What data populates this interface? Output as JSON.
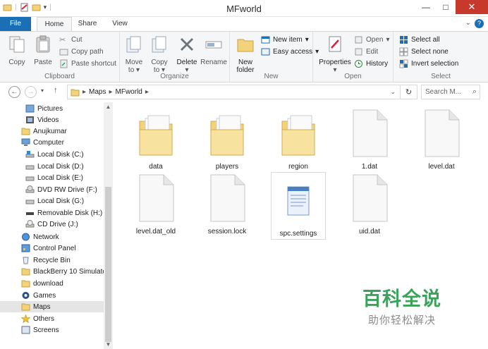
{
  "window": {
    "title": "MFworld"
  },
  "tabs": [
    {
      "label": "File"
    },
    {
      "label": "Home"
    },
    {
      "label": "Share"
    },
    {
      "label": "View"
    }
  ],
  "ribbon": {
    "clipboard": {
      "label": "Clipboard",
      "copy": "Copy",
      "paste": "Paste",
      "cut": "Cut",
      "copy_path": "Copy path",
      "paste_shortcut": "Paste shortcut"
    },
    "organize": {
      "label": "Organize",
      "move_to": "Move",
      "move_to2": "to",
      "copy_to": "Copy",
      "copy_to2": "to",
      "delete": "Delete",
      "rename": "Rename"
    },
    "new": {
      "label": "New",
      "new_folder": "New",
      "new_folder2": "folder",
      "new_item": "New item",
      "easy_access": "Easy access"
    },
    "open": {
      "label": "Open",
      "properties": "Properties",
      "open": "Open",
      "edit": "Edit",
      "history": "History"
    },
    "select": {
      "label": "Select",
      "select_all": "Select all",
      "select_none": "Select none",
      "invert": "Invert selection"
    }
  },
  "address": {
    "crumbs": [
      "Maps",
      "MFworld"
    ],
    "search_placeholder": "Search M..."
  },
  "nav": [
    {
      "label": "Pictures",
      "icon": "pictures-icon"
    },
    {
      "label": "Videos",
      "icon": "videos-icon"
    },
    {
      "label": "Anujkumar",
      "icon": "user-folder-icon"
    },
    {
      "label": "Computer",
      "icon": "computer-icon"
    },
    {
      "label": "Local Disk (C:)",
      "icon": "system-drive-icon"
    },
    {
      "label": "Local Disk (D:)",
      "icon": "drive-icon"
    },
    {
      "label": "Local Disk (E:)",
      "icon": "drive-icon"
    },
    {
      "label": "DVD RW Drive (F:)",
      "icon": "dvd-drive-icon"
    },
    {
      "label": "Local Disk (G:)",
      "icon": "drive-icon"
    },
    {
      "label": "Removable Disk (H:)",
      "icon": "removable-drive-icon"
    },
    {
      "label": "CD Drive (J:)",
      "icon": "cd-drive-icon"
    },
    {
      "label": "Network",
      "icon": "network-icon"
    },
    {
      "label": "Control Panel",
      "icon": "control-panel-icon"
    },
    {
      "label": "Recycle Bin",
      "icon": "recycle-bin-icon"
    },
    {
      "label": "BlackBerry 10 Simulato",
      "icon": "folder-icon"
    },
    {
      "label": "download",
      "icon": "folder-icon"
    },
    {
      "label": "Games",
      "icon": "games-icon"
    },
    {
      "label": "Maps",
      "icon": "folder-icon"
    },
    {
      "label": "Others",
      "icon": "star-icon"
    },
    {
      "label": "Screens",
      "icon": "screens-icon"
    }
  ],
  "files": [
    {
      "name": "data",
      "type": "folder"
    },
    {
      "name": "players",
      "type": "folder"
    },
    {
      "name": "region",
      "type": "folder"
    },
    {
      "name": "1.dat",
      "type": "file"
    },
    {
      "name": "level.dat",
      "type": "file"
    },
    {
      "name": "level.dat_old",
      "type": "file"
    },
    {
      "name": "session.lock",
      "type": "file"
    },
    {
      "name": "spc.settings",
      "type": "doc"
    },
    {
      "name": "uid.dat",
      "type": "file"
    }
  ],
  "watermark": {
    "title": "百科全说",
    "subtitle": "助你轻松解决"
  },
  "colors": {
    "accent": "#1a6fb6",
    "close": "#c7382d",
    "folder": "#f3d37a"
  }
}
